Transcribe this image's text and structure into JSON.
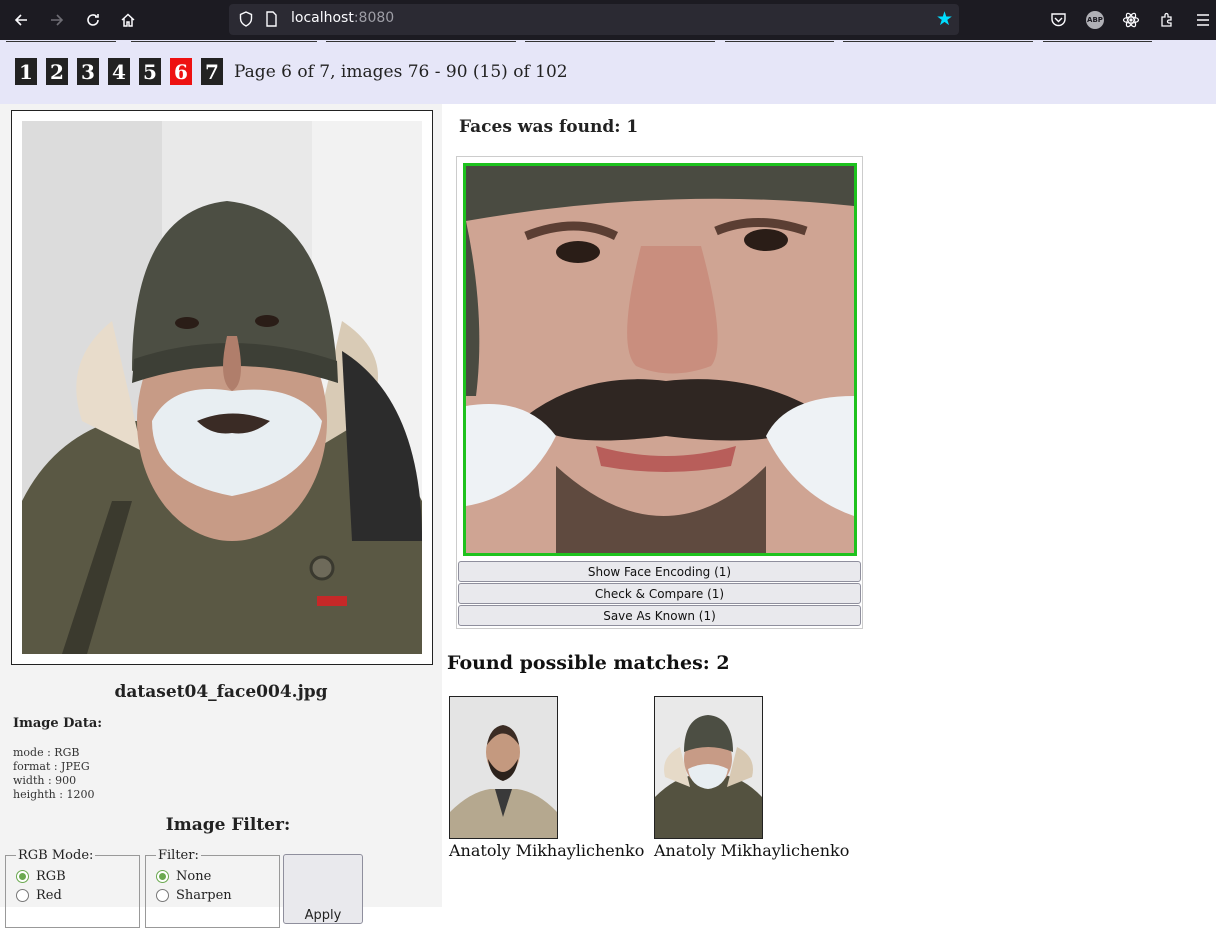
{
  "browser": {
    "url_host": "localhost",
    "url_port": ":8080"
  },
  "pagination": {
    "pages": [
      "1",
      "2",
      "3",
      "4",
      "5",
      "6",
      "7"
    ],
    "active_page": "6",
    "info": "Page 6 of 7, images 76 - 90 (15) of 102"
  },
  "image": {
    "file_name": "dataset04_face004.jpg",
    "data_title": "Image Data:",
    "data": [
      "mode : RGB",
      "format : JPEG",
      "width : 900",
      "heighth : 1200"
    ]
  },
  "filter": {
    "title": "Image Filter:",
    "rgb_legend": "RGB Mode:",
    "rgb_options": [
      "RGB",
      "Red"
    ],
    "rgb_selected": "RGB",
    "filter_legend": "Filter:",
    "filter_options": [
      "None",
      "Sharpen"
    ],
    "filter_selected": "None",
    "apply_label": "Apply"
  },
  "faces": {
    "title": "Faces was found: 1",
    "buttons": {
      "encoding": "Show Face Encoding (1)",
      "compare": "Check & Compare (1)",
      "save": "Save As Known (1)"
    }
  },
  "matches": {
    "title": "Found possible matches: 2",
    "items": [
      {
        "name": "Anatoly Mikhaylichenko"
      },
      {
        "name": "Anatoly Mikhaylichenko"
      }
    ]
  },
  "colors": {
    "header_bg": "#e6e6f8",
    "active_page": "#ee1111",
    "face_box_border": "#1ec21e"
  }
}
